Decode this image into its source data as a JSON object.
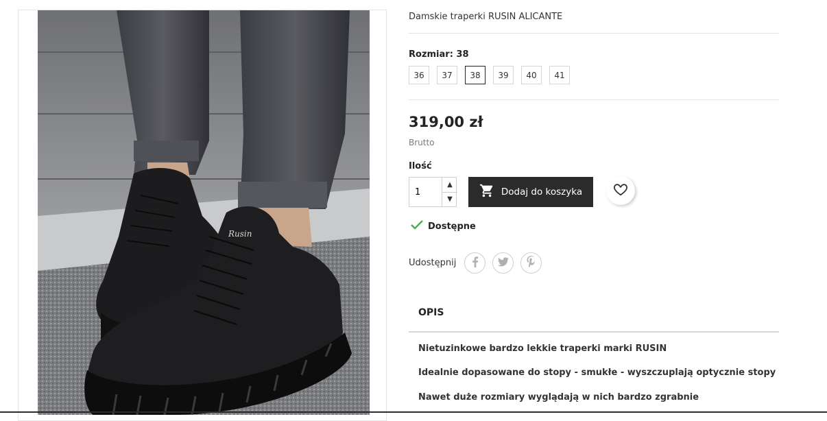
{
  "product": {
    "title": "Damskie traperki RUSIN ALICANTE",
    "size_label": "Rozmiar: 38",
    "sizes": [
      "36",
      "37",
      "38",
      "39",
      "40",
      "41"
    ],
    "selected_size": "38",
    "price": "319,00 zł",
    "tax_label": "Brutto",
    "quantity_label": "Ilość",
    "quantity_value": "1",
    "add_to_cart_label": "Dodaj do koszyka",
    "availability": "Dostępne",
    "share_label": "Udostępnij"
  },
  "tabs": {
    "description_tab": "OPIS"
  },
  "description": [
    "Nietuzinkowe bardzo lekkie traperki marki RUSIN",
    "Idealnie dopasowane do stopy - smukłe - wyszczuplają optycznie stopy",
    "Nawet duże rozmiary wyglądają w nich bardzo zgrabnie"
  ],
  "image": {
    "boot_brand_text": "Rusin"
  },
  "colors": {
    "accent_dark": "#2b2b2b",
    "available_check": "#4caf50"
  },
  "icons": {
    "cart": "cart-icon",
    "wishlist": "heart-icon",
    "facebook": "facebook-icon",
    "twitter": "twitter-icon",
    "pinterest": "pinterest-icon",
    "check": "check-icon"
  }
}
